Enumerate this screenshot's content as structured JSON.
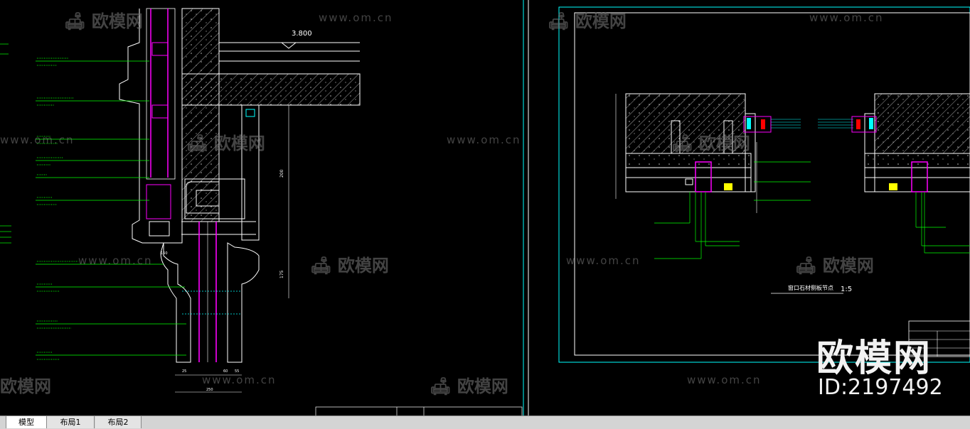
{
  "drawing": {
    "elevation_label": "3.800",
    "scale_label": "1:5",
    "detail_title": "窗口石材侧板节点",
    "dim_200": "200",
    "dim_175": "175",
    "dim_150": "150",
    "dim_60": "60",
    "dim_25": "25",
    "dim_55": "55",
    "dim_250": "250"
  },
  "watermarks": {
    "logo_text": "欧模网",
    "url_text": "www.om.cn",
    "big_text": "欧模网",
    "id_text": "ID:2197492"
  },
  "tabs": [
    {
      "label": "模型",
      "active": true
    },
    {
      "label": "布局1",
      "active": false
    },
    {
      "label": "布局2",
      "active": false
    }
  ],
  "colors": {
    "background": "#000000",
    "annotation_green": "#00ff00",
    "structure_white": "#ffffff",
    "keel_magenta": "#ff00ff",
    "frame_cyan": "#00ffff",
    "dimension_yellow": "#ffff00"
  }
}
